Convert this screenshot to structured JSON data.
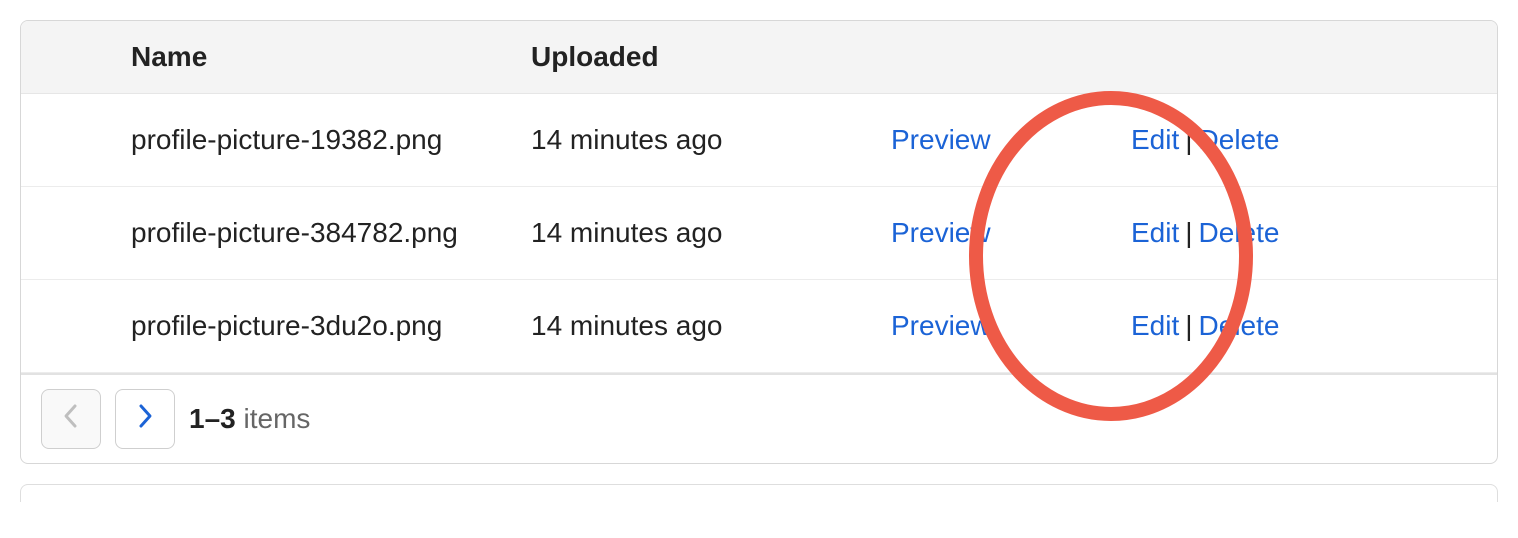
{
  "columns": {
    "name": "Name",
    "uploaded": "Uploaded"
  },
  "actions": {
    "preview": "Preview",
    "edit": "Edit",
    "delete": "Delete",
    "sep": "|"
  },
  "rows": [
    {
      "name": "profile-picture-19382.png",
      "uploaded": "14 minutes ago"
    },
    {
      "name": "profile-picture-384782.png",
      "uploaded": "14 minutes ago"
    },
    {
      "name": "profile-picture-3du2o.png",
      "uploaded": "14 minutes ago"
    }
  ],
  "pagination": {
    "range": "1–3",
    "label": " items"
  }
}
